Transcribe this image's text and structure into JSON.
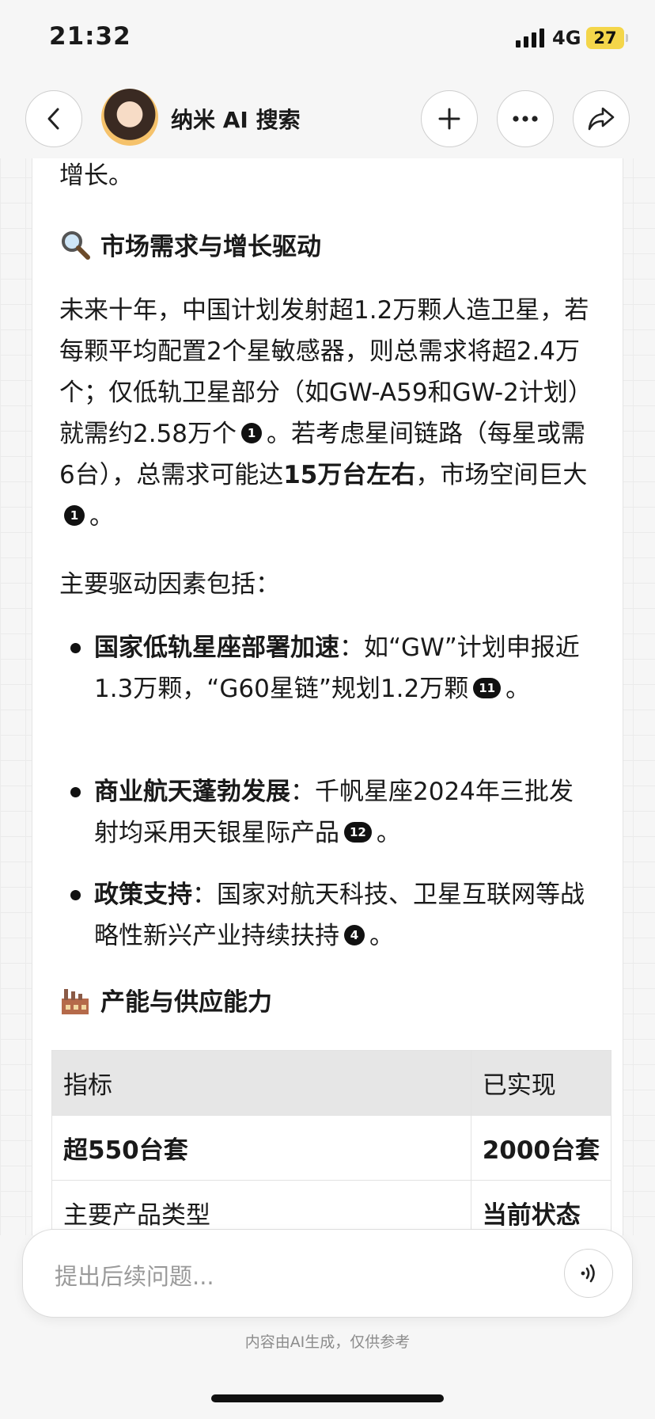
{
  "status_bar": {
    "time": "21:32",
    "network": "4G",
    "battery": "27"
  },
  "nav": {
    "title": "纳米 AI 搜索"
  },
  "content": {
    "partial_top": "增长。",
    "section1_title": "市场需求与增长驱动",
    "para1": {
      "s1": "未来十年，中国计划发射超1.2万颗人造卫星，若每颗平均配置2个星敏感器，则总需求将超2.4万个；仅低轨卫星部分（如GW-A59和GW-2计划）就需约2.58万个",
      "cite1": "1",
      "s2": "。若考虑星间链路（每星或需6台），总需求可能达",
      "bold": "15万台左右",
      "s3": "，市场空间巨大",
      "cite2": "1",
      "s4": "。"
    },
    "drivers_intro": "主要驱动因素包括：",
    "bullets": [
      {
        "bold": "国家低轨星座部署加速",
        "text": "：如“GW”计划申报近1.3万颗，“G60星链”规划1.2万颗",
        "cite": "11",
        "end": "。"
      },
      {
        "bold": "商业航天蓬勃发展",
        "text": "：千帆星座2024年三批发射均采用天银星际产品",
        "cite": "12",
        "end": "。"
      },
      {
        "bold": "政策支持",
        "text": "：国家对航天科技、卫星互联网等战略性新兴产业持续扶持",
        "cite": "4",
        "end": "。"
      }
    ],
    "section2_title": "产能与供应能力",
    "table": {
      "headers": [
        "指标",
        "已实现"
      ],
      "rows": [
        [
          "超550台套",
          "2000台套"
        ],
        [
          "主要产品类型",
          "当前状态"
        ]
      ]
    }
  },
  "input": {
    "placeholder": "提出后续问题..."
  },
  "disclaimer": "内容由AI生成，仅供参考",
  "icons": {
    "back": "chevron-left-icon",
    "add": "plus-icon",
    "more": "ellipsis-icon",
    "share": "share-arrow-icon",
    "voice": "voice-wave-icon",
    "search_emoji": "magnifier-icon",
    "factory_emoji": "factory-icon"
  }
}
